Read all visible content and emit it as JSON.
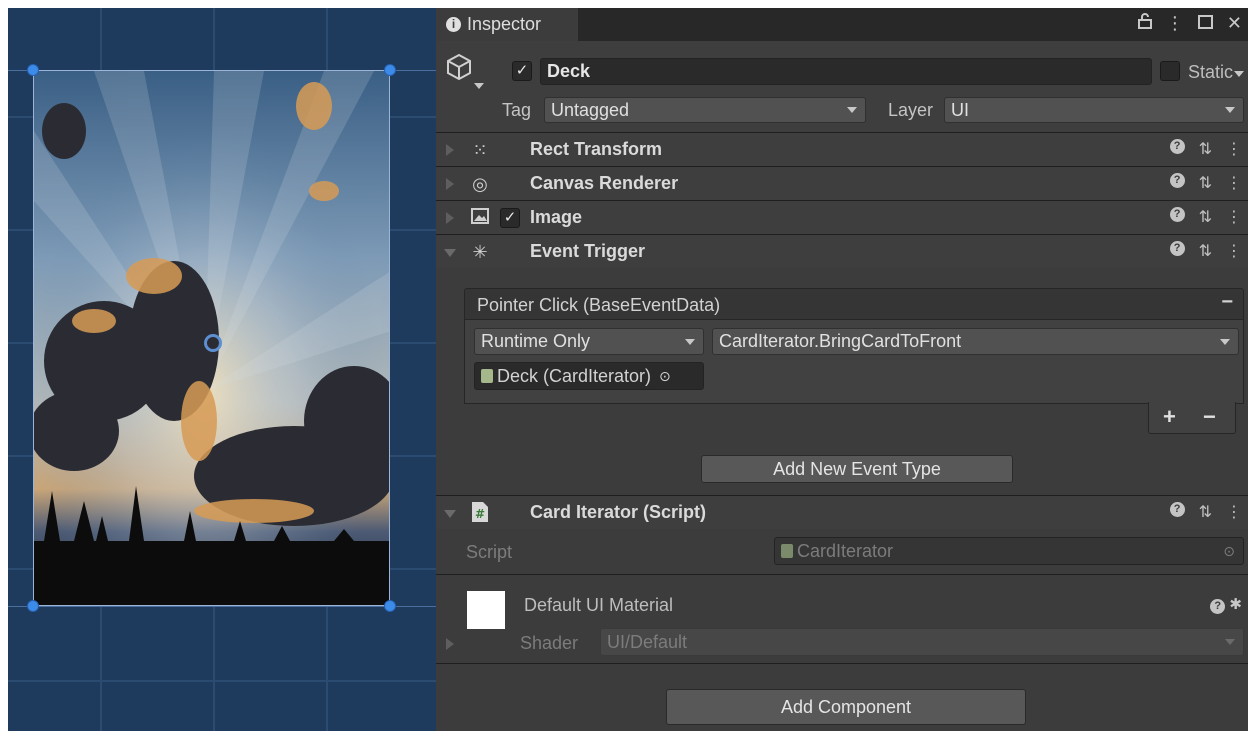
{
  "inspector": {
    "tab_label": "Inspector",
    "tab_icons": [
      "lock-icon",
      "more-icon",
      "maximize-icon",
      "close-icon"
    ],
    "object": {
      "active": true,
      "name": "Deck",
      "static_label": "Static",
      "tag_label": "Tag",
      "tag_value": "Untagged",
      "layer_label": "Layer",
      "layer_value": "UI"
    },
    "components": [
      {
        "name": "Rect Transform",
        "icon": "rect-transform-icon",
        "expanded": false
      },
      {
        "name": "Canvas Renderer",
        "icon": "eye-icon",
        "expanded": false
      },
      {
        "name": "Image",
        "icon": "image-icon",
        "expanded": false,
        "enabled": true
      },
      {
        "name": "Event Trigger",
        "icon": "cursor-click-icon",
        "expanded": true
      },
      {
        "name": "Card Iterator (Script)",
        "icon": "script-icon",
        "expanded": true
      }
    ],
    "event_trigger": {
      "event_header": "Pointer Click (BaseEventData)",
      "runtime_value": "Runtime Only",
      "function_value": "CardIterator.BringCardToFront",
      "target_value": "Deck (CardIterator)",
      "add_label": "+",
      "remove_label": "−",
      "add_event_label": "Add New Event Type"
    },
    "card_iterator": {
      "script_label": "Script",
      "script_value": "CardIterator"
    },
    "material": {
      "name": "Default UI Material",
      "shader_label": "Shader",
      "shader_value": "UI/Default"
    },
    "add_component_label": "Add Component"
  },
  "colors": {
    "scene_bg": "#1e3b5d",
    "inspector_bg": "#3c3c3c",
    "handle": "#3d8be8"
  }
}
